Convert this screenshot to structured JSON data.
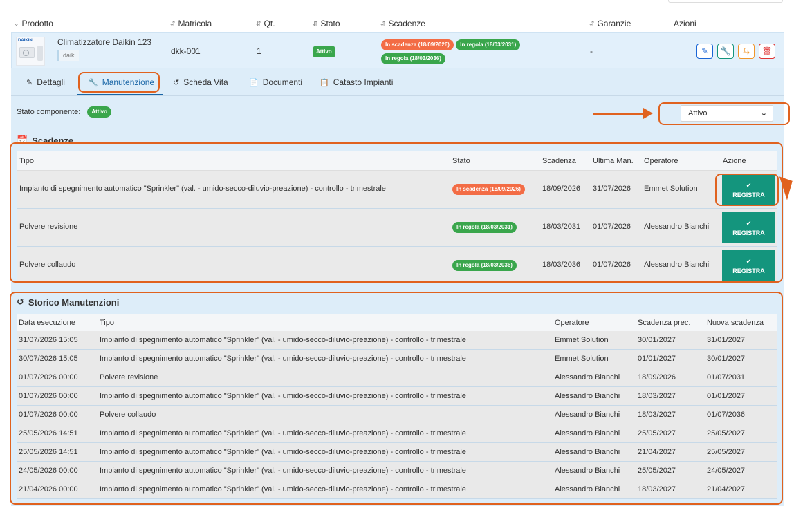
{
  "header": {
    "columns": [
      "Prodotto",
      "Matricola",
      "Qt.",
      "Stato",
      "Scadenze",
      "Garanzie",
      "Azioni"
    ]
  },
  "product": {
    "name": "Climatizzatore Daikin 123",
    "brand_tag": "daik",
    "thumb_logo": "DAIKIN",
    "serial": "dkk-001",
    "qty": "1",
    "status": "Attivo",
    "deadlines": [
      "In scadenza (18/09/2026)",
      "In regola (18/03/2031)",
      "In regola (18/03/2036)"
    ],
    "warranty": "-",
    "actions": {
      "edit_icon": "pencil-icon",
      "maintenance_icon": "wrench-icon",
      "transfer_icon": "swap-icon",
      "delete_icon": "trash-icon",
      "colors": {
        "edit": "#1a66d6",
        "maintenance": "#14957d",
        "transfer": "#f0962a",
        "delete": "#e03535"
      }
    }
  },
  "tabs": [
    {
      "label": "Dettagli",
      "icon": "edit-square-icon"
    },
    {
      "label": "Manutenzione",
      "icon": "wrench-icon",
      "active": true
    },
    {
      "label": "Scheda Vita",
      "icon": "history-icon"
    },
    {
      "label": "Documenti",
      "icon": "file-icon"
    },
    {
      "label": "Catasto Impianti",
      "icon": "clipboard-icon"
    }
  ],
  "component_status": {
    "label": "Stato componente:",
    "badge": "Attivo",
    "select_value": "Attivo"
  },
  "scadenze": {
    "title": "Scadenze",
    "columns": [
      "Tipo",
      "Stato",
      "Scadenza",
      "Ultima Man.",
      "Operatore",
      "Azione"
    ],
    "rows": [
      {
        "tipo": "Impianto di spegnimento automatico \"Sprinkler\" (val. - umido-secco-diluvio-preazione) - controllo - trimestrale",
        "stato": "In scadenza (18/09/2026)",
        "scadenza": "18/09/2026",
        "ultima": "31/07/2026",
        "operatore": "Emmet Solution",
        "azione": "REGISTRA"
      },
      {
        "tipo": "Polvere revisione",
        "stato": "In regola (18/03/2031)",
        "scadenza": "18/03/2031",
        "ultima": "01/07/2026",
        "operatore": "Alessandro Bianchi",
        "azione": "REGISTRA"
      },
      {
        "tipo": "Polvere collaudo",
        "stato": "In regola (18/03/2036)",
        "scadenza": "18/03/2036",
        "ultima": "01/07/2026",
        "operatore": "Alessandro Bianchi",
        "azione": "REGISTRA"
      }
    ],
    "status_colors": {
      "warn": "#f36c45",
      "ok": "#3aa64c"
    },
    "button_color": "#14957d"
  },
  "storico": {
    "title": "Storico Manutenzioni",
    "columns": [
      "Data esecuzione",
      "Tipo",
      "Operatore",
      "Scadenza prec.",
      "Nuova scadenza"
    ],
    "rows": [
      {
        "data": "31/07/2026 15:05",
        "tipo": "Impianto di spegnimento automatico \"Sprinkler\" (val. - umido-secco-diluvio-preazione) - controllo - trimestrale",
        "operatore": "Emmet Solution",
        "prec": "30/01/2027",
        "nuova": "31/01/2027"
      },
      {
        "data": "30/07/2026 15:05",
        "tipo": "Impianto di spegnimento automatico \"Sprinkler\" (val. - umido-secco-diluvio-preazione) - controllo - trimestrale",
        "operatore": "Emmet Solution",
        "prec": "01/01/2027",
        "nuova": "30/01/2027"
      },
      {
        "data": "01/07/2026 00:00",
        "tipo": "Polvere revisione",
        "operatore": "Alessandro Bianchi",
        "prec": "18/09/2026",
        "nuova": "01/07/2031"
      },
      {
        "data": "01/07/2026 00:00",
        "tipo": "Impianto di spegnimento automatico \"Sprinkler\" (val. - umido-secco-diluvio-preazione) - controllo - trimestrale",
        "operatore": "Alessandro Bianchi",
        "prec": "18/03/2027",
        "nuova": "01/01/2027"
      },
      {
        "data": "01/07/2026 00:00",
        "tipo": "Polvere collaudo",
        "operatore": "Alessandro Bianchi",
        "prec": "18/03/2027",
        "nuova": "01/07/2036"
      },
      {
        "data": "25/05/2026 14:51",
        "tipo": "Impianto di spegnimento automatico \"Sprinkler\" (val. - umido-secco-diluvio-preazione) - controllo - trimestrale",
        "operatore": "Alessandro Bianchi",
        "prec": "25/05/2027",
        "nuova": "25/05/2027"
      },
      {
        "data": "25/05/2026 14:51",
        "tipo": "Impianto di spegnimento automatico \"Sprinkler\" (val. - umido-secco-diluvio-preazione) - controllo - trimestrale",
        "operatore": "Alessandro Bianchi",
        "prec": "21/04/2027",
        "nuova": "25/05/2027"
      },
      {
        "data": "24/05/2026 00:00",
        "tipo": "Impianto di spegnimento automatico \"Sprinkler\" (val. - umido-secco-diluvio-preazione) - controllo - trimestrale",
        "operatore": "Alessandro Bianchi",
        "prec": "25/05/2027",
        "nuova": "24/05/2027"
      },
      {
        "data": "21/04/2026 00:00",
        "tipo": "Impianto di spegnimento automatico \"Sprinkler\" (val. - umido-secco-diluvio-preazione) - controllo - trimestrale",
        "operatore": "Alessandro Bianchi",
        "prec": "18/03/2027",
        "nuova": "21/04/2027"
      }
    ]
  },
  "annotation_color": "#e0621f"
}
